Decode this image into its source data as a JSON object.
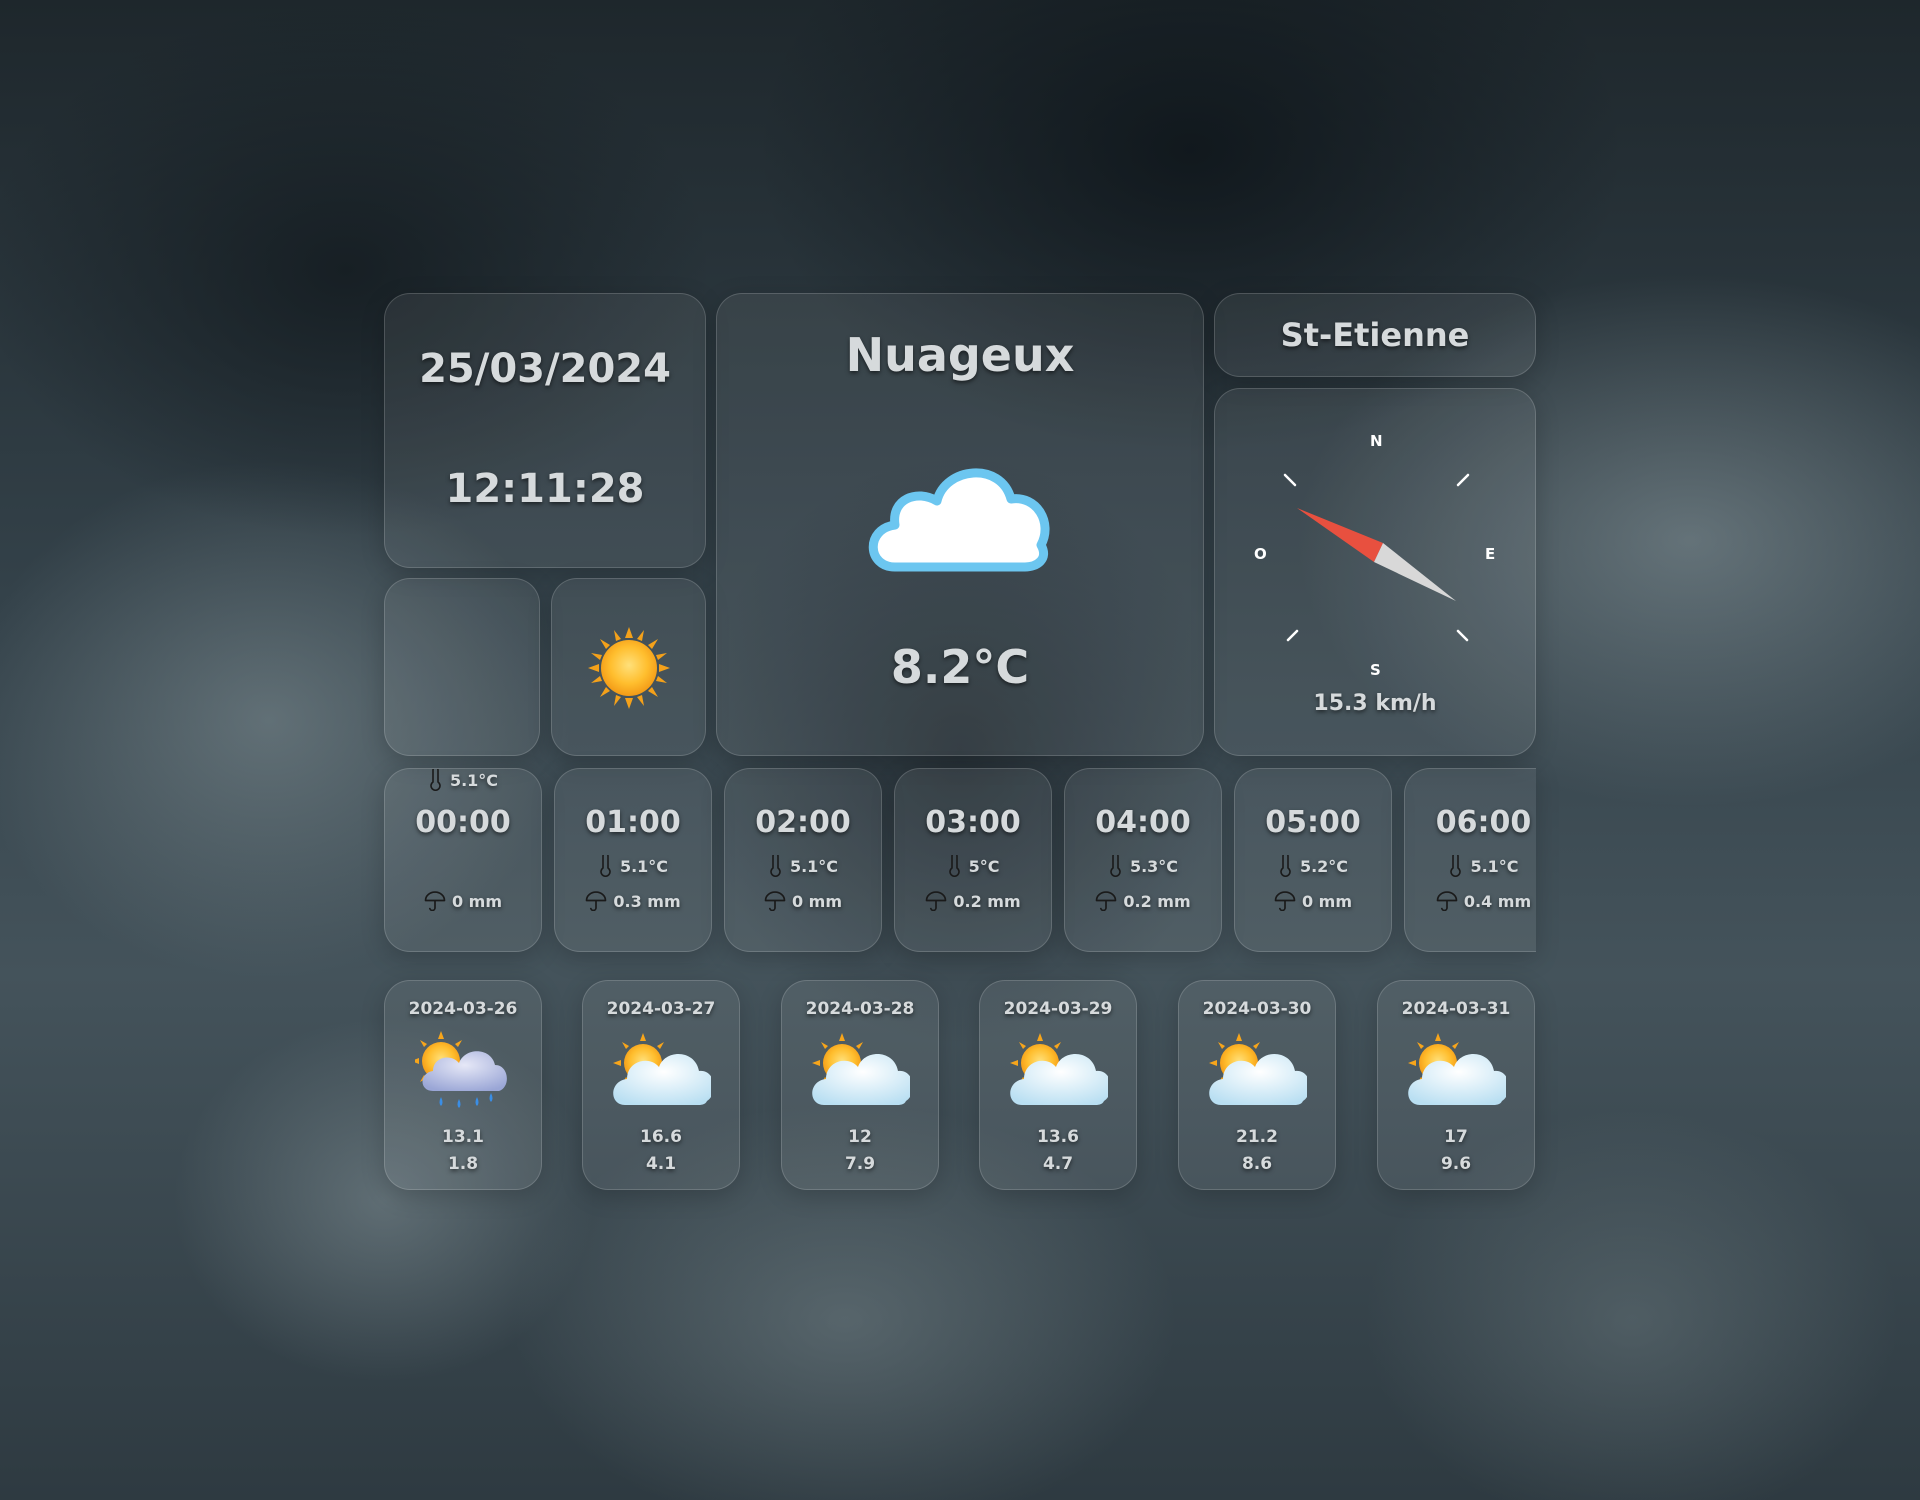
{
  "datetime": {
    "date": "25/03/2024",
    "time": "12:11:28"
  },
  "current": {
    "condition": "Nuageux",
    "temperature": "8.2°C",
    "icon": "cloud-icon"
  },
  "location": {
    "city": "St-Etienne"
  },
  "wind": {
    "speed": "15.3 km/h",
    "direction_icon": "compass-needle-icon",
    "letters": {
      "n": "N",
      "e": "E",
      "s": "S",
      "o": "O"
    }
  },
  "small_tiles": {
    "sun_icon": "sun-icon"
  },
  "hourly": [
    {
      "time": "00:00",
      "temp": "5.1°C",
      "rain": "0 mm"
    },
    {
      "time": "01:00",
      "temp": "5.1°C",
      "rain": "0.3 mm"
    },
    {
      "time": "02:00",
      "temp": "5.1°C",
      "rain": "0 mm"
    },
    {
      "time": "03:00",
      "temp": "5°C",
      "rain": "0.2 mm"
    },
    {
      "time": "04:00",
      "temp": "5.3°C",
      "rain": "0.2 mm"
    },
    {
      "time": "05:00",
      "temp": "5.2°C",
      "rain": "0 mm"
    },
    {
      "time": "06:00",
      "temp": "5.1°C",
      "rain": "0.4 mm"
    }
  ],
  "daily": [
    {
      "date": "2024-03-26",
      "max": "13.1",
      "min": "1.8",
      "icon": "sun-behind-rain-cloud-icon"
    },
    {
      "date": "2024-03-27",
      "max": "16.6",
      "min": "4.1",
      "icon": "sun-behind-cloud-icon"
    },
    {
      "date": "2024-03-28",
      "max": "12",
      "min": "7.9",
      "icon": "sun-behind-cloud-icon"
    },
    {
      "date": "2024-03-29",
      "max": "13.6",
      "min": "4.7",
      "icon": "sun-behind-cloud-icon"
    },
    {
      "date": "2024-03-30",
      "max": "21.2",
      "min": "8.6",
      "icon": "sun-behind-cloud-icon"
    },
    {
      "date": "2024-03-31",
      "max": "17",
      "min": "9.6",
      "icon": "sun-behind-cloud-icon"
    }
  ],
  "colors": {
    "cloud_outline": "#6cc6f0",
    "sun": "#ffb020",
    "needle_north": "#e8503f",
    "needle_south": "#d8d8d8"
  }
}
